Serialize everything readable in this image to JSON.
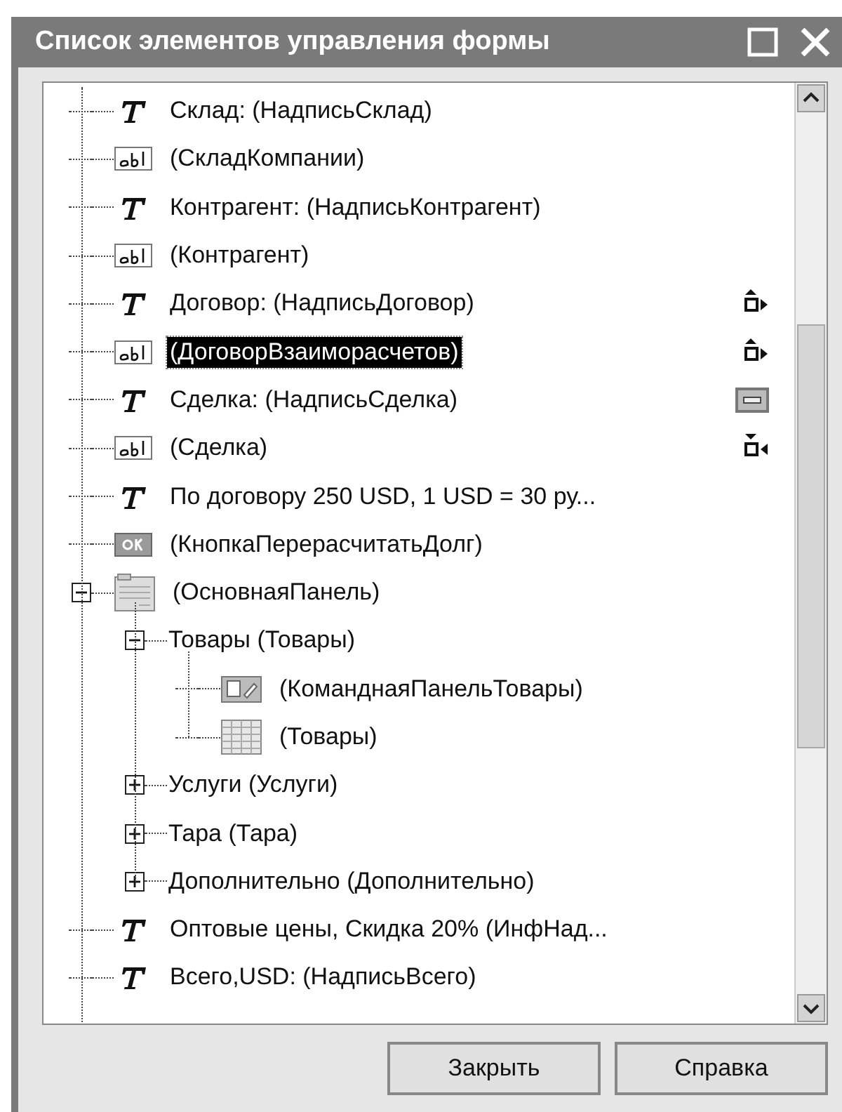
{
  "window": {
    "title": "Список элементов управления формы"
  },
  "items": [
    {
      "kind": "label",
      "text": "Склад: (НадписьСклад)",
      "selected": false
    },
    {
      "kind": "field",
      "text": "(СкладКомпании)",
      "selected": false
    },
    {
      "kind": "label",
      "text": "Контрагент: (НадписьКонтрагент)",
      "selected": false
    },
    {
      "kind": "field",
      "text": "(Контрагент)",
      "selected": false
    },
    {
      "kind": "label",
      "text": "Договор: (НадписьДоговор)",
      "selected": false,
      "anchor": {
        "kind": "top"
      }
    },
    {
      "kind": "field",
      "text": "(ДоговорВзаиморасчетов)",
      "selected": true,
      "anchor": {
        "kind": "top"
      }
    },
    {
      "kind": "label",
      "text": "Сделка: (НадписьСделка)",
      "selected": false,
      "anchor": {
        "kind": "middle"
      }
    },
    {
      "kind": "field",
      "text": "(Сделка)",
      "selected": false,
      "anchor": {
        "kind": "bottom"
      }
    },
    {
      "kind": "label",
      "text": "По договору 250 USD, 1 USD = 30 ру...",
      "selected": false
    },
    {
      "kind": "button",
      "text": "(КнопкаПерерасчитатьДолг)",
      "selected": false
    },
    {
      "kind": "panel",
      "text": "(ОсновнаяПанель)",
      "selected": false,
      "expanded": true,
      "children": [
        {
          "kind": "page",
          "text": "Товары (Товары)",
          "selected": false,
          "expanded": true,
          "children": [
            {
              "kind": "command_bar",
              "text": "(КоманднаяПанельТовары)",
              "selected": false
            },
            {
              "kind": "table",
              "text": "(Товары)",
              "selected": false
            }
          ]
        },
        {
          "kind": "page",
          "text": "Услуги (Услуги)",
          "selected": false,
          "expanded": false
        },
        {
          "kind": "page",
          "text": "Тара (Тара)",
          "selected": false,
          "expanded": false
        },
        {
          "kind": "page",
          "text": "Дополнительно (Дополнительно)",
          "selected": false,
          "expanded": false
        }
      ]
    },
    {
      "kind": "label",
      "text": "Оптовые цены, Скидка 20% (ИнфНад...",
      "selected": false
    },
    {
      "kind": "label",
      "text": "Всего,USD: (НадписьВсего)",
      "selected": false
    }
  ],
  "buttons": [
    {
      "label": "Закрыть"
    },
    {
      "label": "Справка"
    }
  ]
}
